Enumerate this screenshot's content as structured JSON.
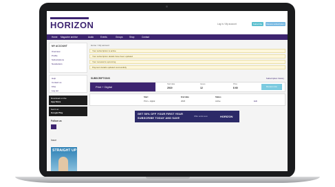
{
  "header": {
    "logo": "HORIZON",
    "account": "Log in / My account",
    "btn_primary": "Subscribe",
    "btn_secondary": "Renew subscription"
  },
  "nav": [
    "Home",
    "Magazine archive",
    "Audio",
    "Events",
    "Groups",
    "Shop",
    "Contact"
  ],
  "sidebar": {
    "account_title": "MY ACCOUNT",
    "account_links": [
      "Overview",
      "Profile",
      "Subscriptions",
      "Newsletters"
    ],
    "help_links": [
      "Help",
      "Contact us",
      "FAQ",
      "Log out"
    ],
    "app_promo": [
      "Download on the",
      "App Store",
      "Get it on",
      "Google Play"
    ],
    "follow_title": "Follow us",
    "magazine_label": "Issue",
    "magazine_title": "STRAIGHT UP"
  },
  "main": {
    "breadcrumb": "Home > My account",
    "alerts": [
      "Your subscription is active",
      "Your subscription details have been updated",
      "Your renewal is upcoming",
      "Payment details updated successfully"
    ],
    "section_title": "SUBSCRIPTIONS",
    "section_link": "Subscription history",
    "subscription": {
      "name": "Print + Digital",
      "stats": [
        {
          "label": "Start date",
          "value": "2019"
        },
        {
          "label": "Issues",
          "value": "12"
        },
        {
          "label": "Price",
          "value": "$ 60"
        }
      ],
      "renew": "Renew now"
    },
    "detail": {
      "headers": [
        "Start",
        "End date",
        "Status"
      ],
      "values": [
        "Print + digital",
        "2020",
        "Active",
        "Edit"
      ]
    },
    "banner": {
      "line1": "GET 50% OFF YOUR FIRST YEAR",
      "line2": "SUBSCRIBE TODAY AND SAVE",
      "sub": "Offer ends soon",
      "logo": "HORIZON"
    }
  }
}
